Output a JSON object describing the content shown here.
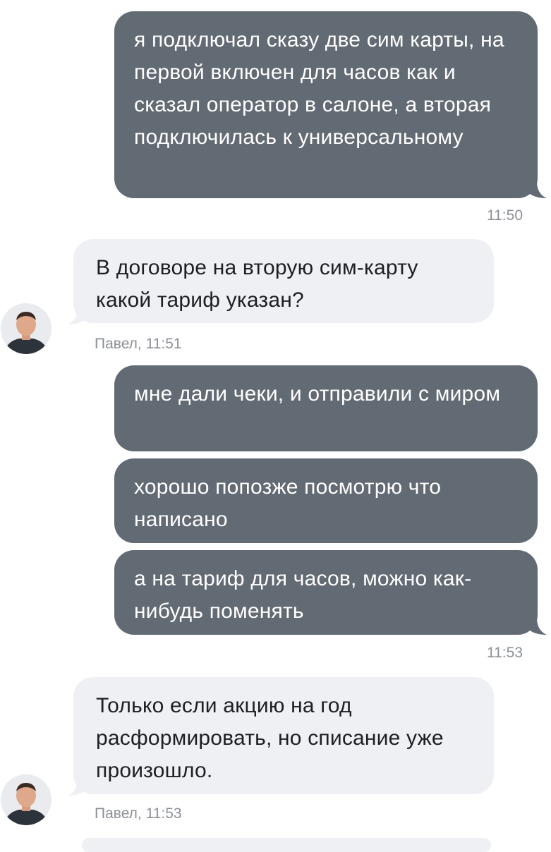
{
  "messages": [
    {
      "text": "я подключал сказу две сим карты, на первой включен для часов как и сказал оператор в салоне, а вторая подключилась к универсальному"
    },
    {
      "text": "В договоре на вторую сим-карту какой тариф указан?"
    },
    {
      "text": "мне дали чеки, и отправили с миром"
    },
    {
      "text": "хорошо попозже посмотрю что написано"
    },
    {
      "text": "а на тариф для часов, можно как-нибудь поменять"
    },
    {
      "text": "Только если акцию на год расформировать, но списание уже произошло."
    }
  ],
  "times": {
    "t1": "11:50",
    "t2": "Павел, 11:51",
    "t3": "11:53",
    "t4": "Павел, 11:53"
  },
  "colors": {
    "outgoing_bubble": "#626a73",
    "incoming_bubble": "#eef0f3",
    "timestamp": "#8b9097"
  }
}
